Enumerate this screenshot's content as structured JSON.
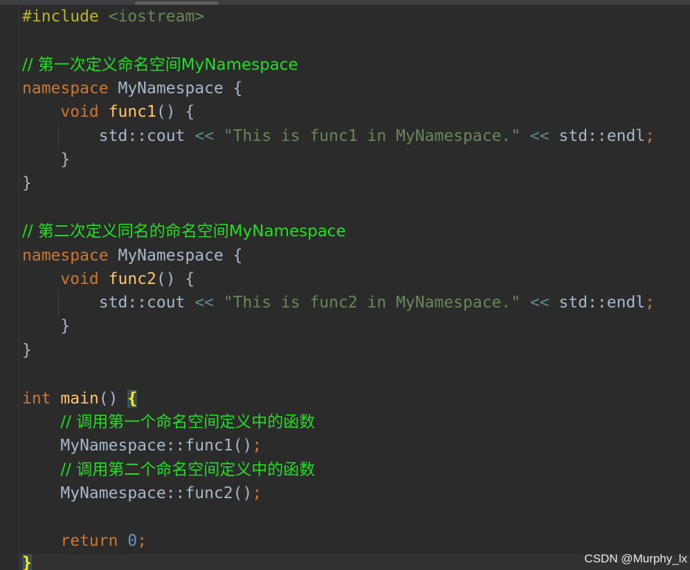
{
  "editor": {
    "lines": {
      "l1_directive": "#include",
      "l1_header": "<iostream>",
      "l3_comment": "// 第一次定义命名空间MyNamespace",
      "l4_kw": "namespace",
      "l4_name": "MyNamespace",
      "l4_brace": "{",
      "l5_kw": "void",
      "l5_fn": "func1",
      "l5_rest": "() {",
      "l6_std1": "std::cout",
      "l6_op1": "<<",
      "l6_str": "\"This is func1 in MyNamespace.\"",
      "l6_op2": "<<",
      "l6_std2": "std::endl",
      "l6_semi": ";",
      "l7_brace": "}",
      "l8_brace": "}",
      "l10_comment": "// 第二次定义同名的命名空间MyNamespace",
      "l11_kw": "namespace",
      "l11_name": "MyNamespace",
      "l11_brace": "{",
      "l12_kw": "void",
      "l12_fn": "func2",
      "l12_rest": "() {",
      "l13_std1": "std::cout",
      "l13_op1": "<<",
      "l13_str": "\"This is func2 in MyNamespace.\"",
      "l13_op2": "<<",
      "l13_std2": "std::endl",
      "l13_semi": ";",
      "l14_brace": "}",
      "l15_brace": "}",
      "l17_kw": "int",
      "l17_fn": "main",
      "l17_paren": "()",
      "l17_brace": "{",
      "l18_comment": "// 调用第一个命名空间定义中的函数",
      "l19_call": "MyNamespace::func1()",
      "l19_semi": ";",
      "l20_comment": "// 调用第二个命名空间定义中的函数",
      "l21_call": "MyNamespace::func2()",
      "l21_semi": ";",
      "l23_kw": "return",
      "l23_num": "0",
      "l23_semi": ";",
      "l24_brace": "}"
    }
  },
  "watermark": "CSDN @Murphy_lx",
  "colors": {
    "background": "#2b2b2b",
    "keyword": "#cc7832",
    "function": "#ffc66d",
    "string": "#6a8759",
    "comment": "#22dd22",
    "number": "#6897bb",
    "default_text": "#a9b7c6"
  }
}
